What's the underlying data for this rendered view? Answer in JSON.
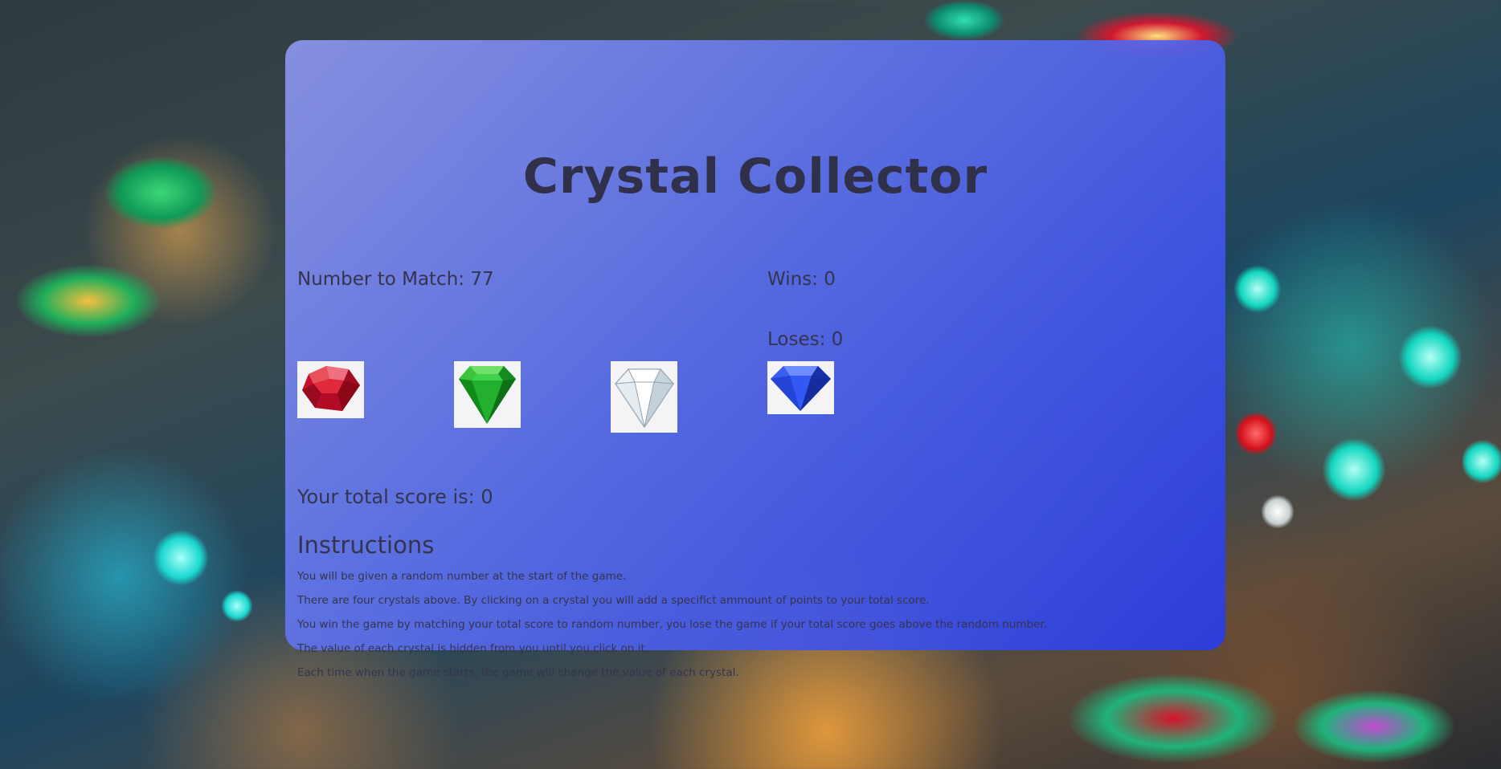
{
  "game": {
    "title": "Crystal Collector",
    "number_to_match_label": "Number to Match: ",
    "number_to_match_value": "77",
    "wins_label": "Wins: ",
    "wins_value": "0",
    "loses_label": "Loses: ",
    "loses_value": "0",
    "score_label": "Your total score is: ",
    "score_value": "0"
  },
  "crystals": [
    {
      "name": "ruby",
      "color": "#c8102e"
    },
    {
      "name": "emerald",
      "color": "#1fa22a"
    },
    {
      "name": "diamond",
      "color": "#d8e4ec"
    },
    {
      "name": "sapphire",
      "color": "#1d3fd0"
    }
  ],
  "instructions": {
    "heading": "Instructions",
    "lines": [
      "You will be given a random number at the start of the game.",
      "There are four crystals above. By clicking on a crystal you will add a specifict ammount of points to your total score.",
      "You win the game by matching your total score to random number, you lose the game if your total score goes above the random number.",
      "The value of each crystal is hidden from you until you click on it.",
      "Each time when the game starts, the game will change the value of each crystal."
    ]
  },
  "colors": {
    "panel_start": "#8c96eb",
    "panel_end": "#283ce6",
    "text": "#33334d"
  }
}
